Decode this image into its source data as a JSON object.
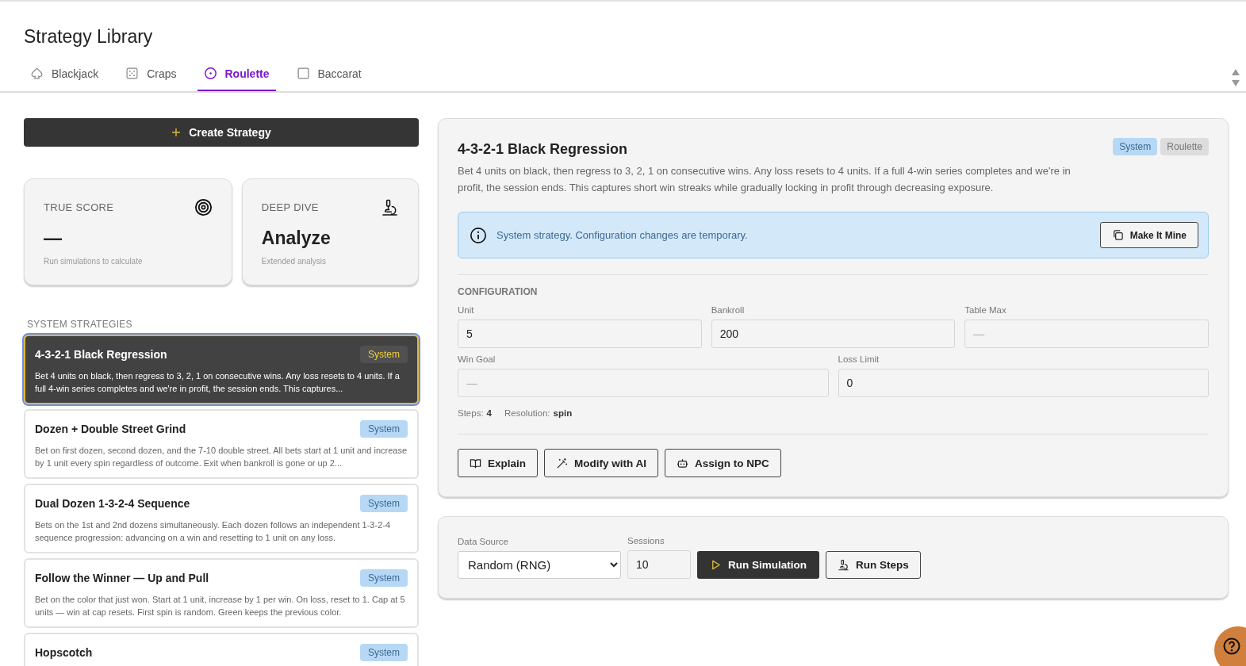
{
  "page": {
    "title": "Strategy Library"
  },
  "tabs": [
    {
      "label": "Blackjack",
      "selected": false
    },
    {
      "label": "Craps",
      "selected": false
    },
    {
      "label": "Roulette",
      "selected": true
    },
    {
      "label": "Baccarat",
      "selected": false
    }
  ],
  "create_button": "Create Strategy",
  "stat_cards": [
    {
      "label": "TRUE SCORE",
      "value": "—",
      "note": "Run simulations to calculate"
    },
    {
      "label": "DEEP DIVE",
      "value": "Analyze",
      "note": "Extended analysis"
    }
  ],
  "section_label": "SYSTEM STRATEGIES",
  "strategies": [
    {
      "name": "4-3-2-1 Black Regression",
      "badge": "System",
      "description": "Bet 4 units on black, then regress to 3, 2, 1 on consecutive wins. Any loss resets to 4 units. If a full 4-win series completes and we're in profit, the session ends. This captures...",
      "selected": true
    },
    {
      "name": "Dozen + Double Street Grind",
      "badge": "System",
      "description": "Bet on first dozen, second dozen, and the 7-10 double street. All bets start at 1 unit and increase by 1 unit every spin regardless of outcome. Exit when bankroll is gone or up 2...",
      "selected": false
    },
    {
      "name": "Dual Dozen 1-3-2-4 Sequence",
      "badge": "System",
      "description": "Bets on the 1st and 2nd dozens simultaneously. Each dozen follows an independent 1-3-2-4 sequence progression: advancing on a win and resetting to 1 unit on any loss.",
      "selected": false
    },
    {
      "name": "Follow the Winner — Up and Pull",
      "badge": "System",
      "description": "Bet on the color that just won. Start at 1 unit, increase by 1 per win. On loss, reset to 1. Cap at 5 units — win at cap resets. First spin is random. Green keeps the previous color.",
      "selected": false
    },
    {
      "name": "Hopscotch",
      "badge": "System",
      "selected": false
    }
  ],
  "detail": {
    "title": "4-3-2-1 Black Regression",
    "tags": [
      {
        "label": "System",
        "kind": "system"
      },
      {
        "label": "Roulette",
        "kind": "game"
      }
    ],
    "description": "Bet 4 units on black, then regress to 3, 2, 1 on consecutive wins. Any loss resets to 4 units. If a full 4-win series completes and we're in profit, the session ends. This captures short win streaks while gradually locking in profit through decreasing exposure.",
    "notice": "System strategy. Configuration changes are temporary.",
    "notice_button": "Make It Mine",
    "config_label": "CONFIGURATION",
    "fields_row_1": [
      {
        "label": "Unit",
        "value": "5"
      },
      {
        "label": "Bankroll",
        "value": "200"
      },
      {
        "label": "Table Max",
        "placeholder": "—"
      }
    ],
    "fields_row_2": [
      {
        "label": "Win Goal",
        "placeholder": "—"
      },
      {
        "label": "Loss Limit",
        "value": "0"
      }
    ],
    "meta": [
      {
        "label": "Steps:",
        "value": "4"
      },
      {
        "label": "Resolution:",
        "value": "spin"
      }
    ],
    "actions": [
      {
        "label": "Explain"
      },
      {
        "label": "Modify with AI"
      },
      {
        "label": "Assign to NPC"
      }
    ]
  },
  "simulation": {
    "data_source_label": "Data Source",
    "data_source": "Random (RNG)",
    "sessions_label": "Sessions",
    "sessions": "10",
    "run_button": "Run Simulation",
    "steps_button": "Run Steps"
  }
}
